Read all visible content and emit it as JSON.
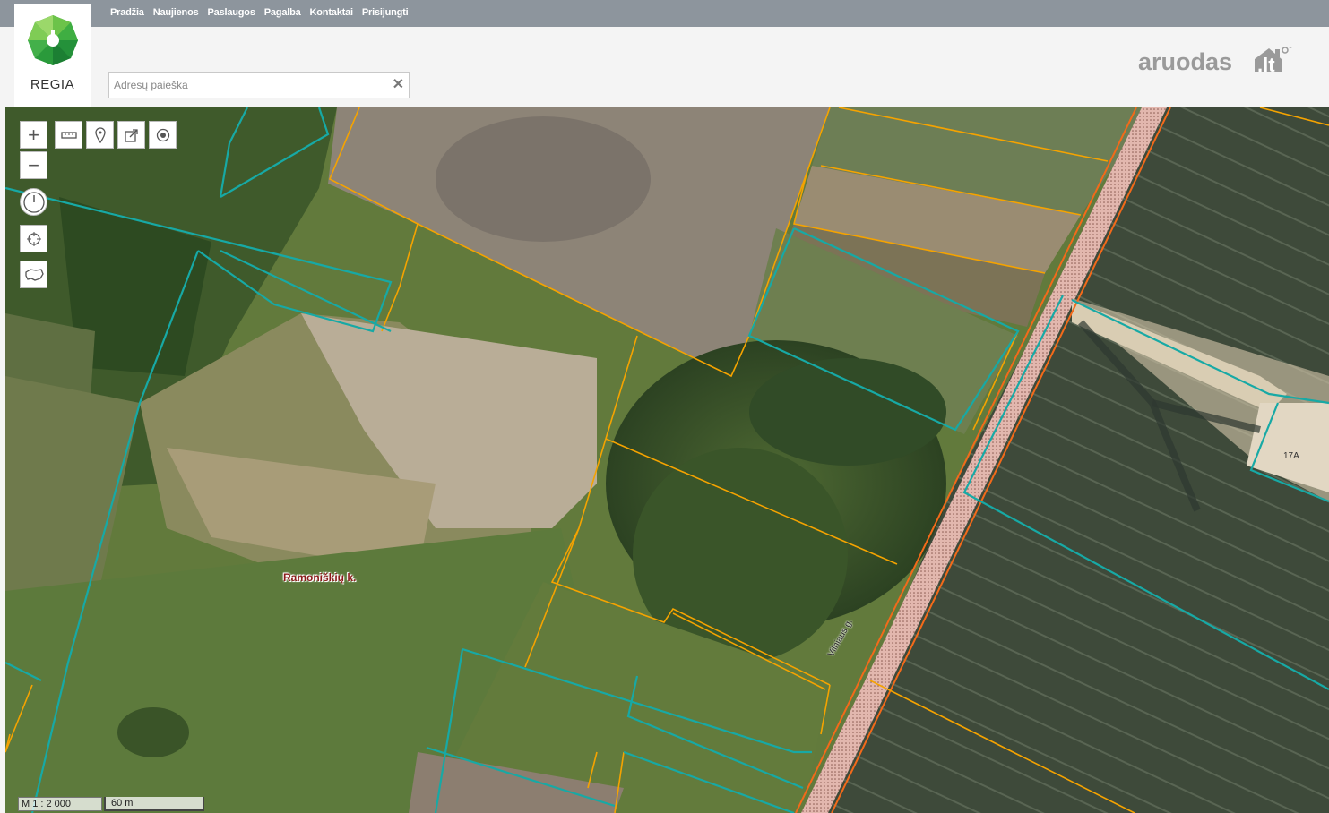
{
  "nav": {
    "items": [
      "Pradžia",
      "Naujienos",
      "Paslaugos",
      "Pagalba",
      "Kontaktai",
      "Prisijungti"
    ]
  },
  "logo": {
    "text": "REGIA"
  },
  "search": {
    "placeholder": "Adresų paieška",
    "value": "",
    "clear_icon": "close-icon"
  },
  "brand": {
    "text": "aruodas",
    "suffix": ".lt",
    "color": "#9a9a9a",
    "accent": "#9a9a9a"
  },
  "map_controls": [
    {
      "name": "zoom-in-button",
      "icon": "plus-icon"
    },
    {
      "name": "zoom-out-button",
      "icon": "minus-icon"
    },
    {
      "name": "measure-button",
      "icon": "ruler-icon"
    },
    {
      "name": "marker-button",
      "icon": "pin-icon"
    },
    {
      "name": "share-button",
      "icon": "share-icon"
    },
    {
      "name": "locate-button",
      "icon": "target-dot-icon"
    },
    {
      "name": "history-button",
      "icon": "clock-icon"
    },
    {
      "name": "crosshair-button",
      "icon": "crosshair-icon"
    },
    {
      "name": "lithuania-extent-button",
      "icon": "country-outline-icon"
    }
  ],
  "map": {
    "place_label": "Ramoniškių k.",
    "street_label": "Vilniaus g.",
    "parcel_label": "17A",
    "colors": {
      "parcel_border": "#f5a300",
      "cadastre_border": "#17a9a5",
      "road": "#e8b8b0",
      "road_edge": "#f36a1a"
    }
  },
  "scale": {
    "ratio": "M 1 : 2 000",
    "bar": "60 m"
  }
}
